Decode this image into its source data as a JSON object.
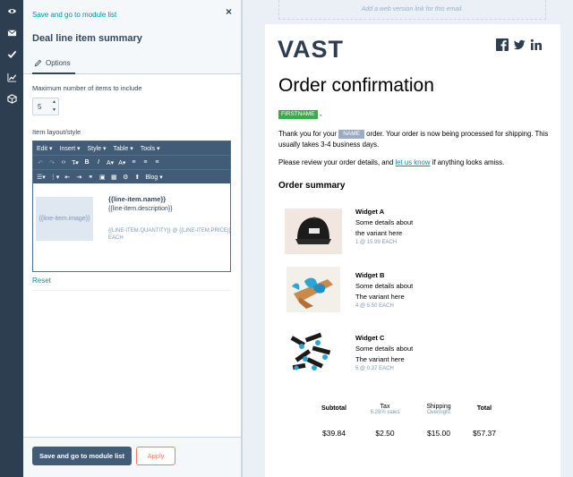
{
  "rail": {
    "icons": [
      "eye-icon",
      "mail-icon",
      "check-icon",
      "chart-icon",
      "box-icon"
    ]
  },
  "panel": {
    "back_link": "Save and go to module list",
    "close_symbol": "×",
    "title": "Deal line item summary",
    "tab_options": "Options",
    "max_items_label": "Maximum number of items to include",
    "max_items_value": "5",
    "layout_label": "Item layout/style",
    "editor": {
      "menus": [
        "Edit ▾",
        "Insert ▾",
        "Style ▾",
        "Table ▾",
        "Tools ▾"
      ],
      "blog_label": "Blog ▾",
      "image_placeholder": "{{line-item.image}}",
      "name_token": "{{line-item.name}}",
      "desc_token": "{{line-item.description}}",
      "qty_token": "{{LINE-ITEM.QUANTITY}} @ {{LINE-ITEM.PRICE}} EACH"
    },
    "reset_link": "Reset",
    "primary_button": "Save and go to module list",
    "apply_button": "Apply"
  },
  "email": {
    "web_version": "Add a web version link for this email.",
    "logo_text": "VAST",
    "heading": "Order confirmation",
    "firstname_token": "FIRSTNAME",
    "comma": ",",
    "thanks_before": "Thank you for your ",
    "name_token": "NAME",
    "thanks_after": " order. Your order is now being processed for shipping. This usually takes 3-4 business days.",
    "review_before": "Please review your order details, and ",
    "review_link": "let us know",
    "review_after": " if anything looks amiss.",
    "summary_heading": "Order summary",
    "items": [
      {
        "name": "Widget A",
        "line1": "Some details about",
        "line2": "the variant here",
        "qty": "1 @ 15.99 EACH"
      },
      {
        "name": "Widget B",
        "line1": "Some details about",
        "line2": "The variant here",
        "qty": "4 @ 5.50 EACH"
      },
      {
        "name": "Widget C",
        "line1": "Some details about",
        "line2": "The variant here",
        "qty": "5 @ 0.37 EACH"
      }
    ],
    "totals": {
      "subtotal_label": "Subtotal",
      "tax_label": "Tax",
      "tax_sub": "6.25% sales",
      "shipping_label": "Shipping",
      "shipping_sub": "Overnight",
      "total_label": "Total",
      "subtotal_value": "$39.84",
      "tax_value": "$2.50",
      "shipping_value": "$15.00",
      "total_value": "$57.37"
    }
  }
}
